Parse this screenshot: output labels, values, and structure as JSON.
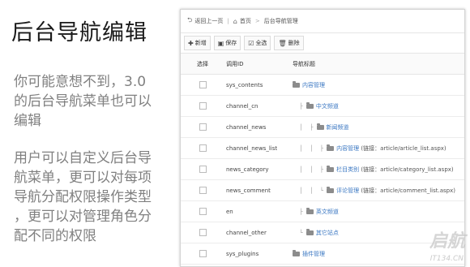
{
  "left": {
    "title": "后台导航编辑",
    "para1": "你可能意想不到，3.0\n的后台导航菜单也可以\n编辑",
    "para2": "用户可以自定义后台导\n航菜单，更可以对每项\n导航分配权限操作类型\n，更可以对管理角色分\n配不同的权限"
  },
  "breadcrumb": {
    "back_label": "返回上一页",
    "home_label": "首页",
    "current_label": "后台导航管理"
  },
  "toolbar": {
    "add_label": "新增",
    "save_label": "保存",
    "select_all_label": "全选",
    "delete_label": "删除"
  },
  "table": {
    "headers": {
      "select": "选择",
      "call_id": "调用ID",
      "nav_title": "导航标题"
    },
    "rows": [
      {
        "id": "sys_contents",
        "title": "内容管理",
        "note": ""
      },
      {
        "id": "channel_cn",
        "title": "中文频道",
        "note": ""
      },
      {
        "id": "channel_news",
        "title": "新闻频道",
        "note": ""
      },
      {
        "id": "channel_news_list",
        "title": "内容管理",
        "note": "(链接：article/article_list.aspx)"
      },
      {
        "id": "news_category",
        "title": "栏目类别",
        "note": "(链接：article/category_list.aspx)"
      },
      {
        "id": "news_comment",
        "title": "评论管理",
        "note": "(链接：article/comment_list.aspx)"
      },
      {
        "id": "en",
        "title": "英文频道",
        "note": ""
      },
      {
        "id": "channel_other",
        "title": "其它站点",
        "note": ""
      },
      {
        "id": "sys_plugins",
        "title": "插件管理",
        "note": ""
      }
    ]
  },
  "watermark": {
    "text": "启航",
    "sub": "IT134.CN"
  },
  "colors": {
    "link": "#3a77c2",
    "body_text": "#808080"
  },
  "icons": [
    "back-icon",
    "home-icon",
    "add-icon",
    "save-icon",
    "select-all-icon",
    "delete-icon",
    "folder-icon"
  ]
}
